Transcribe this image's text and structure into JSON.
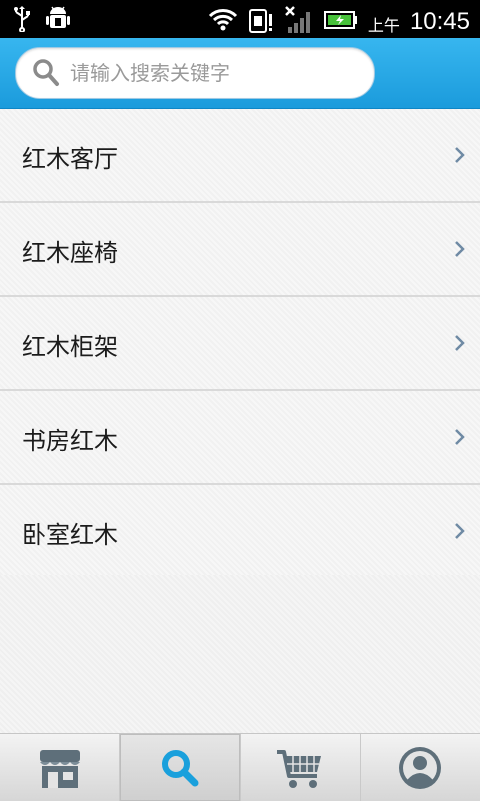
{
  "status": {
    "ampm": "上午",
    "time": "10:45"
  },
  "search": {
    "placeholder": "请输入搜索关键字"
  },
  "list": {
    "items": [
      {
        "label": "红木客厅"
      },
      {
        "label": "红木座椅"
      },
      {
        "label": "红木柜架"
      },
      {
        "label": "书房红木"
      },
      {
        "label": "卧室红木"
      }
    ]
  },
  "tabs": [
    {
      "icon": "store-icon"
    },
    {
      "icon": "search-icon",
      "active": true
    },
    {
      "icon": "cart-icon"
    },
    {
      "icon": "user-icon"
    }
  ],
  "colors": {
    "header_top": "#37b6ef",
    "header_bottom": "#1b9bdc",
    "accent": "#1aa0dc"
  }
}
